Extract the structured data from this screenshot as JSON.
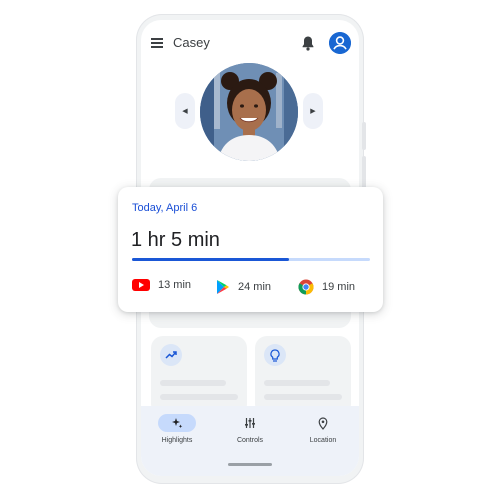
{
  "header": {
    "child_name": "Casey"
  },
  "usage_card": {
    "date": "Today, April 6",
    "total_time": "1 hr 5 min",
    "progress_fraction": 0.66,
    "apps": [
      {
        "icon": "youtube-icon",
        "time": "13 min"
      },
      {
        "icon": "google-play-icon",
        "time": "24 min"
      },
      {
        "icon": "chrome-icon",
        "time": "19 min"
      }
    ]
  },
  "tiles": [
    {
      "icon": "trending-up-icon"
    },
    {
      "icon": "lightbulb-icon"
    }
  ],
  "bottom_nav": {
    "items": [
      {
        "label": "Highlights",
        "icon": "sparkle-icon",
        "active": true
      },
      {
        "label": "Controls",
        "icon": "sliders-icon",
        "active": false
      },
      {
        "label": "Location",
        "icon": "location-pin-icon",
        "active": false
      }
    ]
  },
  "colors": {
    "accent_blue": "#1a57d6",
    "progress_track": "#c6dafc",
    "youtube_red": "#ff0000"
  }
}
